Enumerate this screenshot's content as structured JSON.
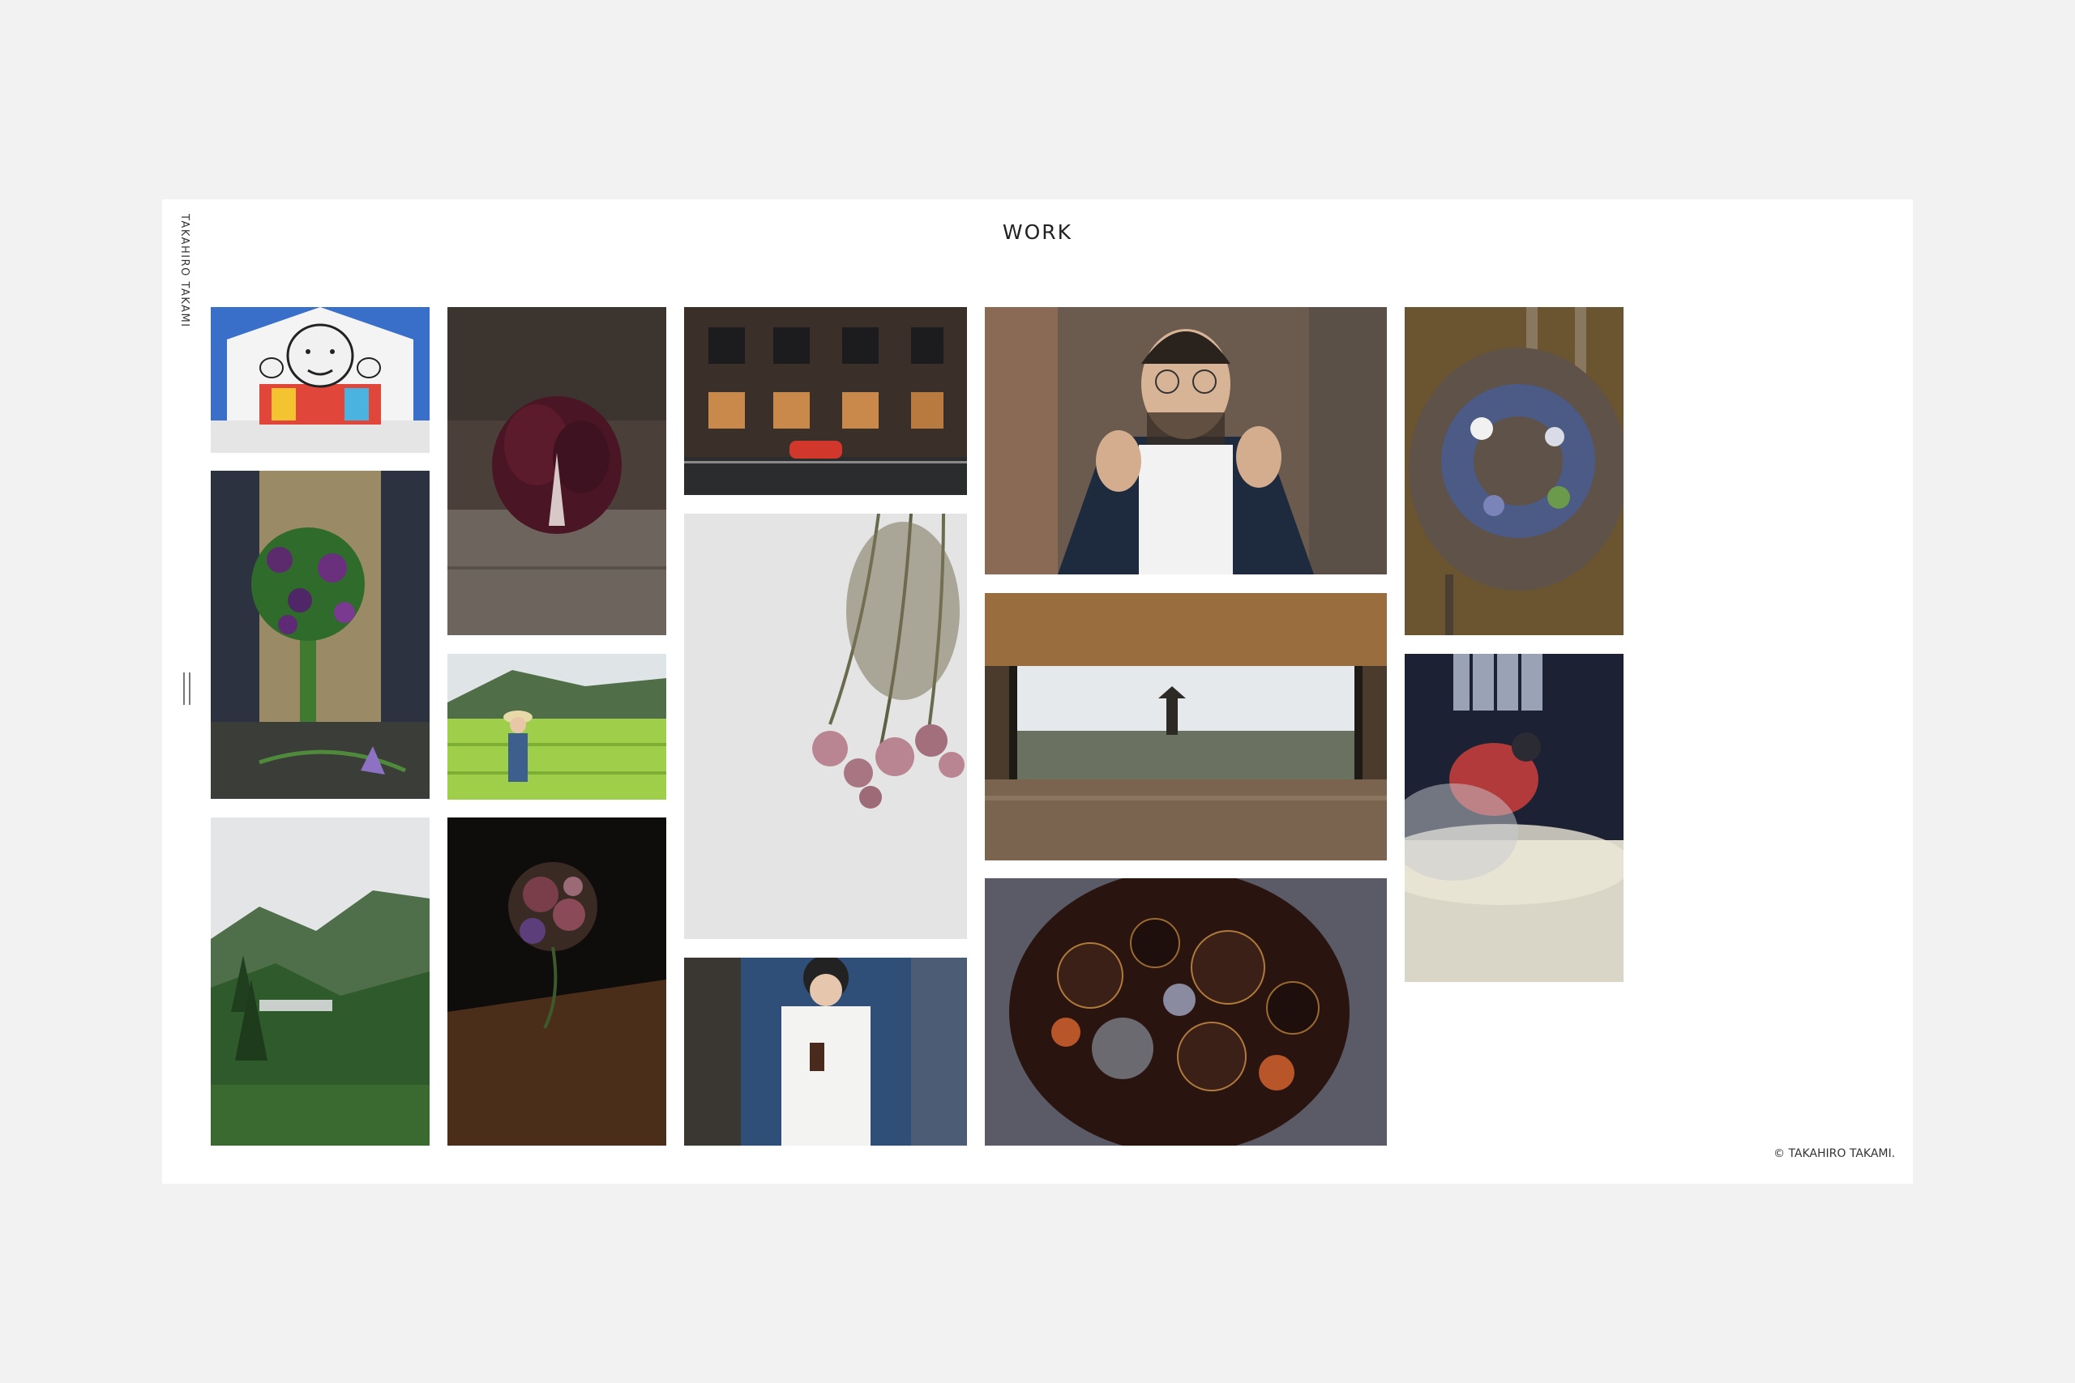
{
  "site": {
    "brand": "TAKAHIRO TAKAMI"
  },
  "page": {
    "title": "WORK"
  },
  "footer": {
    "copyright": "© TAKAHIRO TAKAMI."
  },
  "menu": {
    "icon": "menu-icon"
  },
  "gallery": [
    {
      "id": "mural",
      "subject": "painted mural on building"
    },
    {
      "id": "radicchio",
      "subject": "radicchio on wooden table"
    },
    {
      "id": "building-car",
      "subject": "brick building with red car at dusk"
    },
    {
      "id": "portrait-man",
      "subject": "man with glasses adjusting jacket"
    },
    {
      "id": "wreath-chair",
      "subject": "flower wreath on wooden chair"
    },
    {
      "id": "bouquet-apron",
      "subject": "person holding purple flower bouquet"
    },
    {
      "id": "rice-terrace-girl",
      "subject": "child in rice terraces"
    },
    {
      "id": "dried-flowers",
      "subject": "hanging dried flowers"
    },
    {
      "id": "kyoto-view",
      "subject": "view of Kyoto pagoda through window"
    },
    {
      "id": "steam-worker",
      "subject": "worker in steam with rice"
    },
    {
      "id": "forest-mountain",
      "subject": "forested mountain valley"
    },
    {
      "id": "dark-bouquet",
      "subject": "dark floral arrangement on table"
    },
    {
      "id": "woman-glass",
      "subject": "woman holding glass by blue wall"
    },
    {
      "id": "lacquer-plate",
      "subject": "lacquered plate with circle pattern"
    }
  ]
}
